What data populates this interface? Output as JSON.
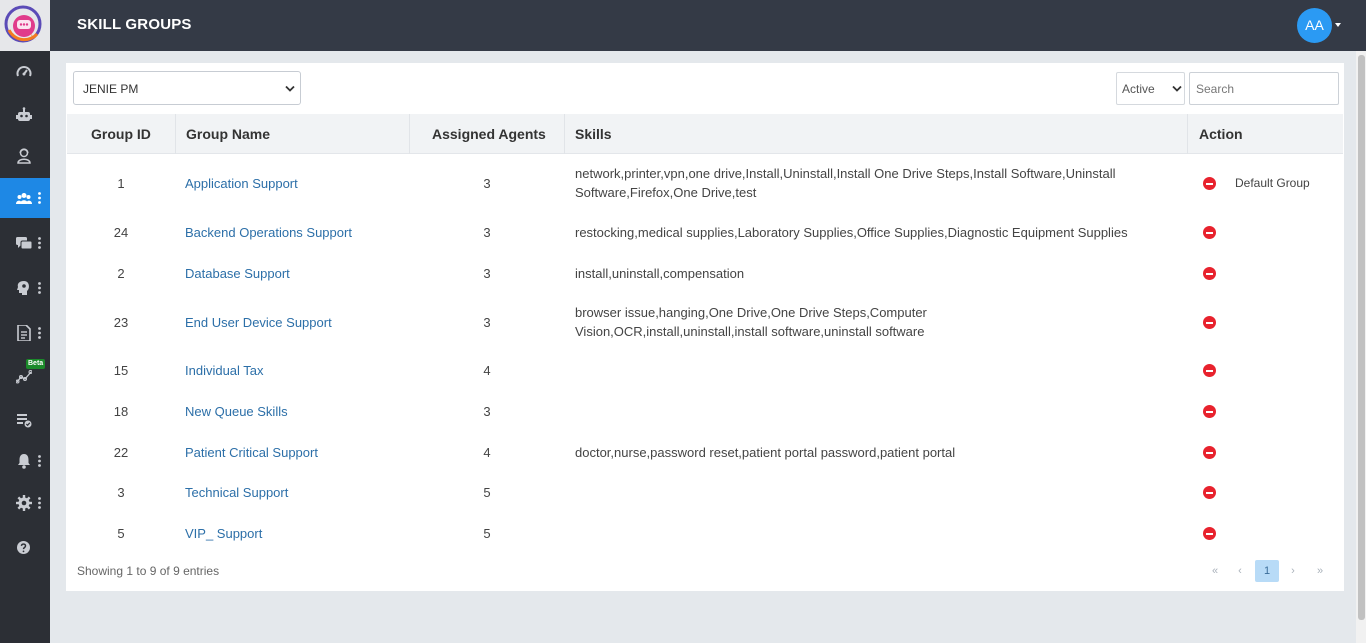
{
  "header": {
    "title": "SKILL GROUPS",
    "avatar_initials": "AA"
  },
  "sidebar": {
    "beta_badge": "Beta",
    "items": [
      {
        "name": "dashboard",
        "icon": "speedometer-icon",
        "active": false,
        "has_menu": false
      },
      {
        "name": "bots",
        "icon": "robot-icon",
        "active": false,
        "has_menu": false
      },
      {
        "name": "agents",
        "icon": "agent-icon",
        "active": false,
        "has_menu": false
      },
      {
        "name": "skill-groups",
        "icon": "users-group-icon",
        "active": true,
        "has_menu": true
      },
      {
        "name": "conversations",
        "icon": "chat-icon",
        "active": false,
        "has_menu": true
      },
      {
        "name": "knowledge",
        "icon": "brain-icon",
        "active": false,
        "has_menu": true
      },
      {
        "name": "reports",
        "icon": "document-icon",
        "active": false,
        "has_menu": true
      },
      {
        "name": "analytics",
        "icon": "graph-icon",
        "active": false,
        "has_menu": false
      },
      {
        "name": "tasks",
        "icon": "list-check-icon",
        "active": false,
        "has_menu": false
      },
      {
        "name": "notifications",
        "icon": "bell-icon",
        "active": false,
        "has_menu": true
      },
      {
        "name": "settings",
        "icon": "gear-icon",
        "active": false,
        "has_menu": true
      },
      {
        "name": "help",
        "icon": "question-icon",
        "active": false,
        "has_menu": false
      }
    ]
  },
  "filters": {
    "project_value": "JENIE PM",
    "status_value": "Active",
    "search_placeholder": "Search"
  },
  "table": {
    "columns": [
      "Group ID",
      "Group Name",
      "Assigned Agents",
      "Skills",
      "Action"
    ],
    "rows": [
      {
        "id": "1",
        "name": "Application Support",
        "agents": "3",
        "skills": "network,printer,vpn,one drive,Install,Uninstall,Install One Drive Steps,Install Software,Uninstall Software,Firefox,One Drive,test",
        "default_label": "Default Group"
      },
      {
        "id": "24",
        "name": "Backend Operations Support",
        "agents": "3",
        "skills": "restocking,medical supplies,Laboratory Supplies,Office Supplies,Diagnostic Equipment Supplies",
        "default_label": ""
      },
      {
        "id": "2",
        "name": "Database Support",
        "agents": "3",
        "skills": "install,uninstall,compensation",
        "default_label": ""
      },
      {
        "id": "23",
        "name": "End User Device Support",
        "agents": "3",
        "skills": "browser issue,hanging,One Drive,One Drive Steps,Computer Vision,OCR,install,uninstall,install software,uninstall software",
        "default_label": ""
      },
      {
        "id": "15",
        "name": "Individual Tax",
        "agents": "4",
        "skills": "",
        "default_label": ""
      },
      {
        "id": "18",
        "name": "New Queue Skills",
        "agents": "3",
        "skills": "",
        "default_label": ""
      },
      {
        "id": "22",
        "name": "Patient Critical Support",
        "agents": "4",
        "skills": "doctor,nurse,password reset,patient portal password,patient portal",
        "default_label": ""
      },
      {
        "id": "3",
        "name": "Technical Support",
        "agents": "5",
        "skills": "",
        "default_label": ""
      },
      {
        "id": "5",
        "name": "VIP_ Support",
        "agents": "5",
        "skills": "",
        "default_label": ""
      }
    ],
    "info": "Showing 1 to 9 of 9 entries"
  },
  "pagination": {
    "first": "«",
    "prev": "‹",
    "current": "1",
    "next": "›",
    "last": "»"
  }
}
